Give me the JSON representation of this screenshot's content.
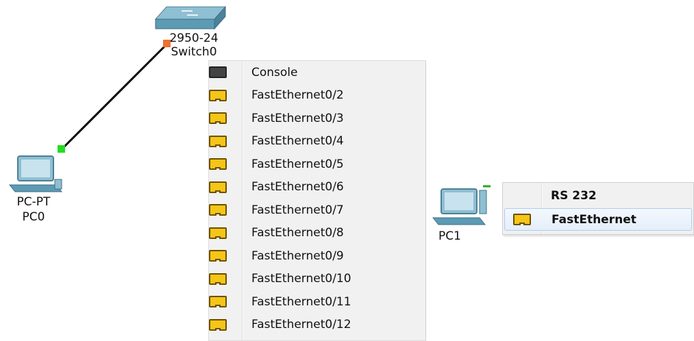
{
  "workspace": {
    "switch": {
      "model": "2950-24",
      "name": "Switch0"
    },
    "pc0": {
      "model": "PC-PT",
      "name": "PC0"
    },
    "pc1": {
      "name": "PC1"
    }
  },
  "switch_port_menu": {
    "items": [
      {
        "label": "Console",
        "icon": "console-port-icon"
      },
      {
        "label": "FastEthernet0/2",
        "icon": "ethernet-port-icon"
      },
      {
        "label": "FastEthernet0/3",
        "icon": "ethernet-port-icon"
      },
      {
        "label": "FastEthernet0/4",
        "icon": "ethernet-port-icon"
      },
      {
        "label": "FastEthernet0/5",
        "icon": "ethernet-port-icon"
      },
      {
        "label": "FastEthernet0/6",
        "icon": "ethernet-port-icon"
      },
      {
        "label": "FastEthernet0/7",
        "icon": "ethernet-port-icon"
      },
      {
        "label": "FastEthernet0/8",
        "icon": "ethernet-port-icon"
      },
      {
        "label": "FastEthernet0/9",
        "icon": "ethernet-port-icon"
      },
      {
        "label": "FastEthernet0/10",
        "icon": "ethernet-port-icon"
      },
      {
        "label": "FastEthernet0/11",
        "icon": "ethernet-port-icon"
      },
      {
        "label": "FastEthernet0/12",
        "icon": "ethernet-port-icon"
      }
    ]
  },
  "pc1_port_menu": {
    "items": [
      {
        "label": "RS 232"
      },
      {
        "label": "FastEthernet",
        "icon": "ethernet-port-icon",
        "highlighted": true
      }
    ]
  },
  "colors": {
    "ethernet_port": "#f5c518",
    "console_port": "#444444",
    "link_up": "#22dd22",
    "link_down": "#f07030",
    "cable": "#000000"
  }
}
